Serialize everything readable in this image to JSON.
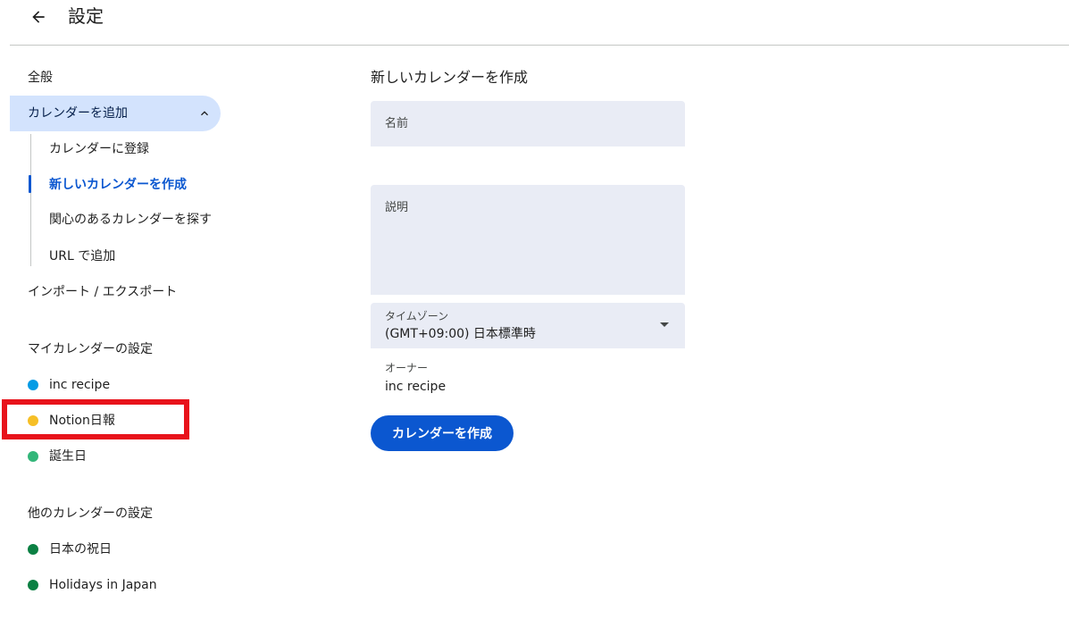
{
  "header": {
    "title": "設定",
    "back_icon": "arrow-left-icon"
  },
  "sidebar": {
    "general": "全般",
    "add_calendar": "カレンダーを追加",
    "add_calendar_icon": "chevron-up-icon",
    "sub_items": [
      {
        "label": "カレンダーに登録"
      },
      {
        "label": "新しいカレンダーを作成"
      },
      {
        "label": "関心のあるカレンダーを探す"
      },
      {
        "label": "URL で追加"
      }
    ],
    "import_export": "インポート / エクスポート",
    "my_calendars_heading": "マイカレンダーの設定",
    "my_calendars": [
      {
        "label": "inc recipe",
        "color": "#039be5"
      },
      {
        "label": "Notion日報",
        "color": "#f6bf26"
      },
      {
        "label": "誕生日",
        "color": "#33b679"
      }
    ],
    "other_calendars_heading": "他のカレンダーの設定",
    "other_calendars": [
      {
        "label": "日本の祝日",
        "color": "#0b8043"
      },
      {
        "label": "Holidays in Japan",
        "color": "#0b8043"
      }
    ]
  },
  "main": {
    "heading": "新しいカレンダーを作成",
    "name_placeholder": "名前",
    "description_placeholder": "説明",
    "timezone_label": "タイムゾーン",
    "timezone_value": "(GMT+09:00) 日本標準時",
    "timezone_icon": "dropdown-caret-icon",
    "owner_label": "オーナー",
    "owner_value": "inc recipe",
    "create_button": "カレンダーを作成"
  },
  "colors": {
    "accent": "#0b57d0",
    "active_nav_bg": "#d3e3fd",
    "field_bg": "#e9ecf5",
    "highlight": "#e8131b"
  }
}
